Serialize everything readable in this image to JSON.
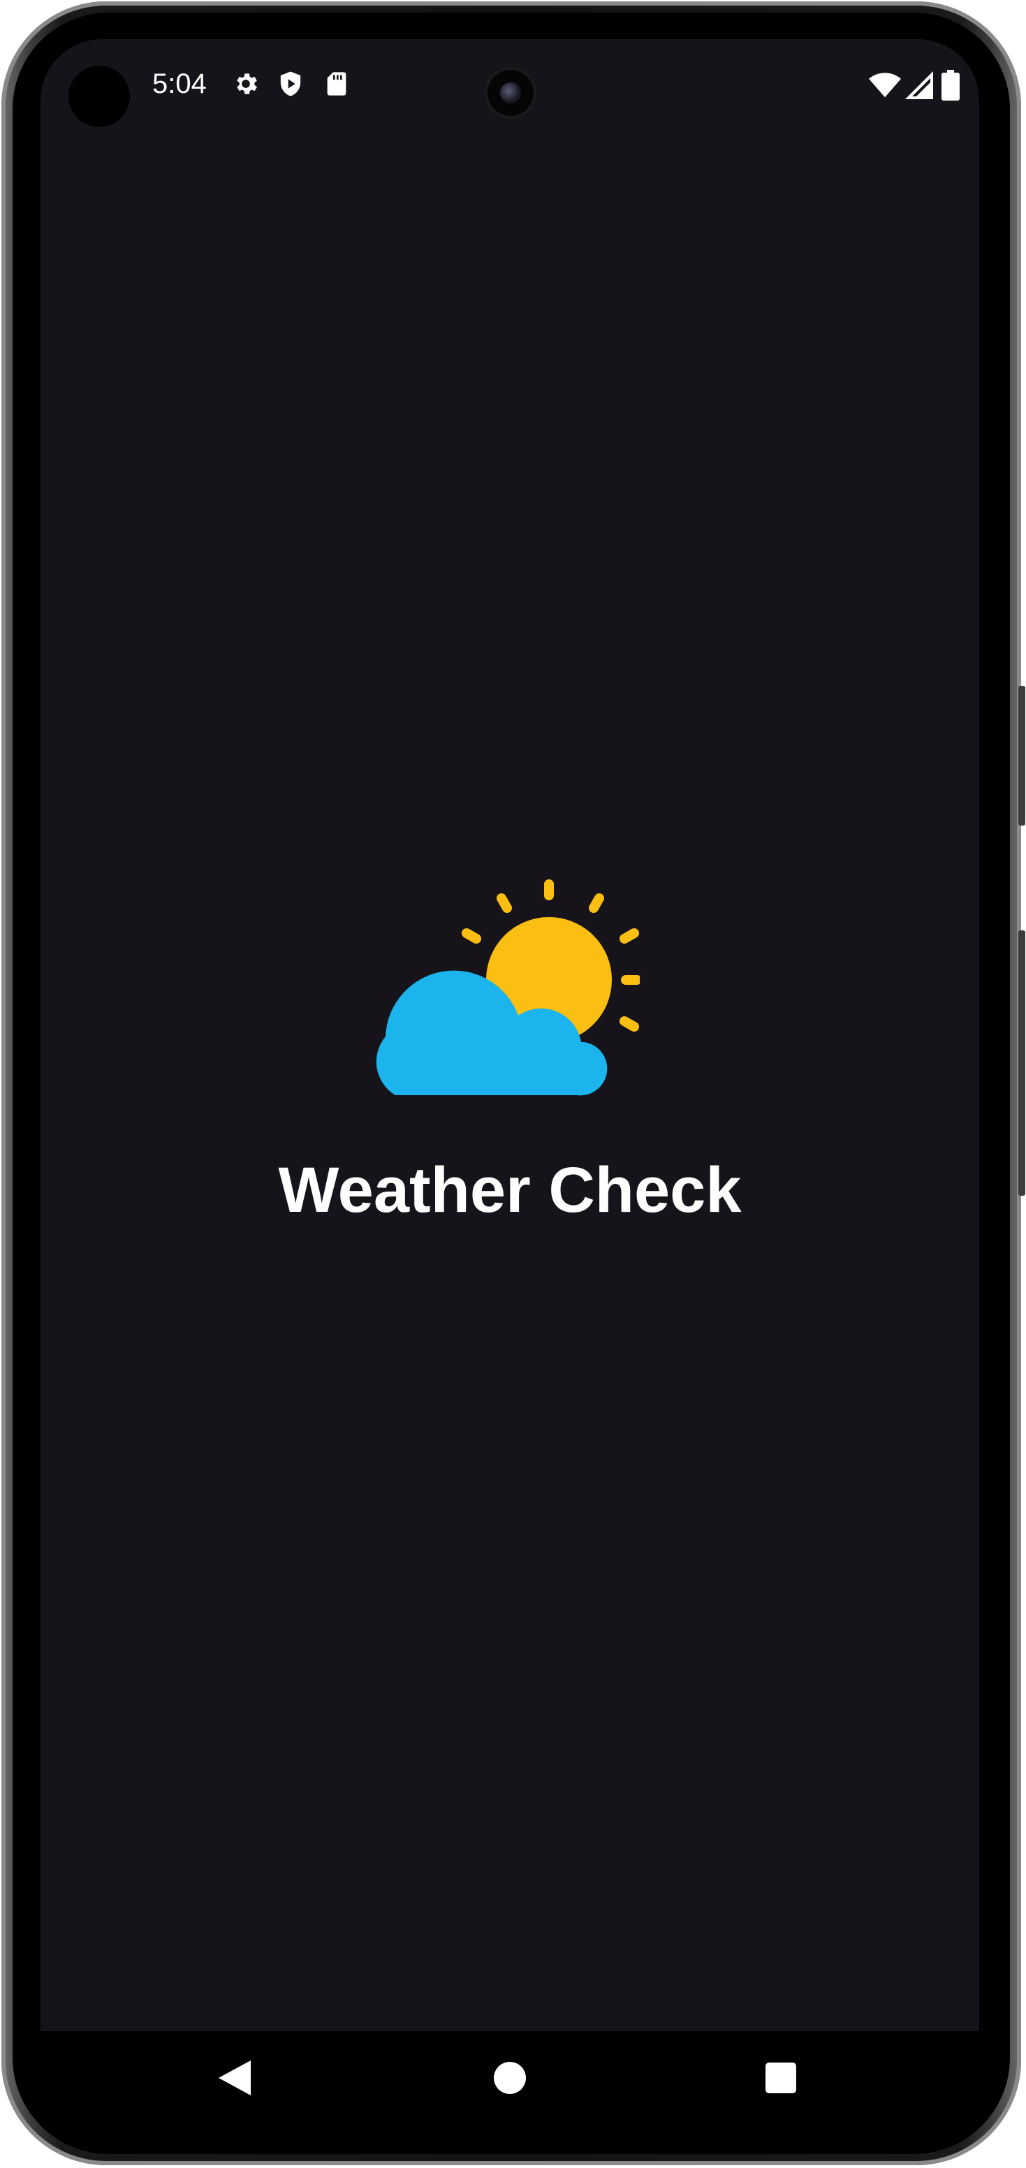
{
  "status_bar": {
    "time": "5:04",
    "left_icons": [
      "settings-icon",
      "shield-play-icon",
      "sd-card-icon"
    ],
    "right_icons": [
      "wifi-icon",
      "cell-signal-icon",
      "battery-icon"
    ]
  },
  "splash": {
    "logo_icon": "partly-cloudy-icon",
    "title": "Weather Check",
    "colors": {
      "background": "#16141a",
      "sun": "#fbbf14",
      "cloud": "#1cb4ec",
      "title": "#ffffff"
    }
  },
  "nav_bar": {
    "buttons": [
      "back-button",
      "home-button",
      "recents-button"
    ]
  }
}
